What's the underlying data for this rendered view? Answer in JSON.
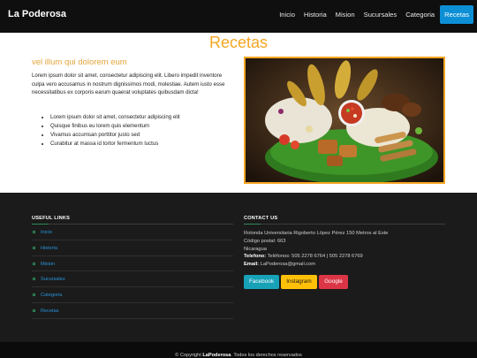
{
  "brand": "La Poderosa",
  "nav": [
    {
      "label": "Inicio"
    },
    {
      "label": "Historia"
    },
    {
      "label": "Mision"
    },
    {
      "label": "Sucursales"
    },
    {
      "label": "Categoria"
    },
    {
      "label": "Recetas"
    }
  ],
  "page": {
    "title": "Recetas",
    "subtitle": "vel illum qui dolorem eum",
    "paragraph": "Lorem ipsum dolor sit amet, consectetur adipiscing elit. Libero impedit inventore culpa vero accusamus in nostrum dignissimos modi, molestiae. Autem iusto esse necessitatibus ex corporis earum quaerat voluptates quibusdam dicta!",
    "bullets": [
      "Lorem ipsum dolor sit amet, consectetur adipiscing elit",
      "Quisque finibus eu lorem quis elementum",
      "Vivamus accumsan porttitor justo sed",
      "Curabitur at massa id tortor fermentum luctus"
    ]
  },
  "footer": {
    "links_heading": "USEFUL LINKS",
    "links": [
      {
        "label": "Inicio"
      },
      {
        "label": "Historia"
      },
      {
        "label": "Mision"
      },
      {
        "label": "Sucursales"
      },
      {
        "label": "Categoria"
      },
      {
        "label": "Recetas"
      }
    ],
    "contact_heading": "CONTACT US",
    "address": "Rotonda Universitaria Rigoberto López Pérez 150 Metros al Este",
    "postal": "Código postal: 663",
    "country": "Nicaragua",
    "phone_label": "Telefono:",
    "phone_value": "Teléfonos: 505 2278 6764 | 505 2278 6769",
    "email_label": "Email:",
    "email_value": "LaPoderosa@gmail.com",
    "social": [
      {
        "label": "Facebook",
        "color": "#17a2b8"
      },
      {
        "label": "Instagram",
        "color": "#ffc107"
      },
      {
        "label": "Google",
        "color": "#dc3545"
      }
    ],
    "copyright_prefix": "© Copyright",
    "copyright_brand": "LaPoderosa",
    "copyright_suffix": ". Todos los derechos reservados"
  },
  "colors": {
    "accent": "#f5a623",
    "active_nav": "#0d8fd6",
    "link": "#2894d8"
  }
}
